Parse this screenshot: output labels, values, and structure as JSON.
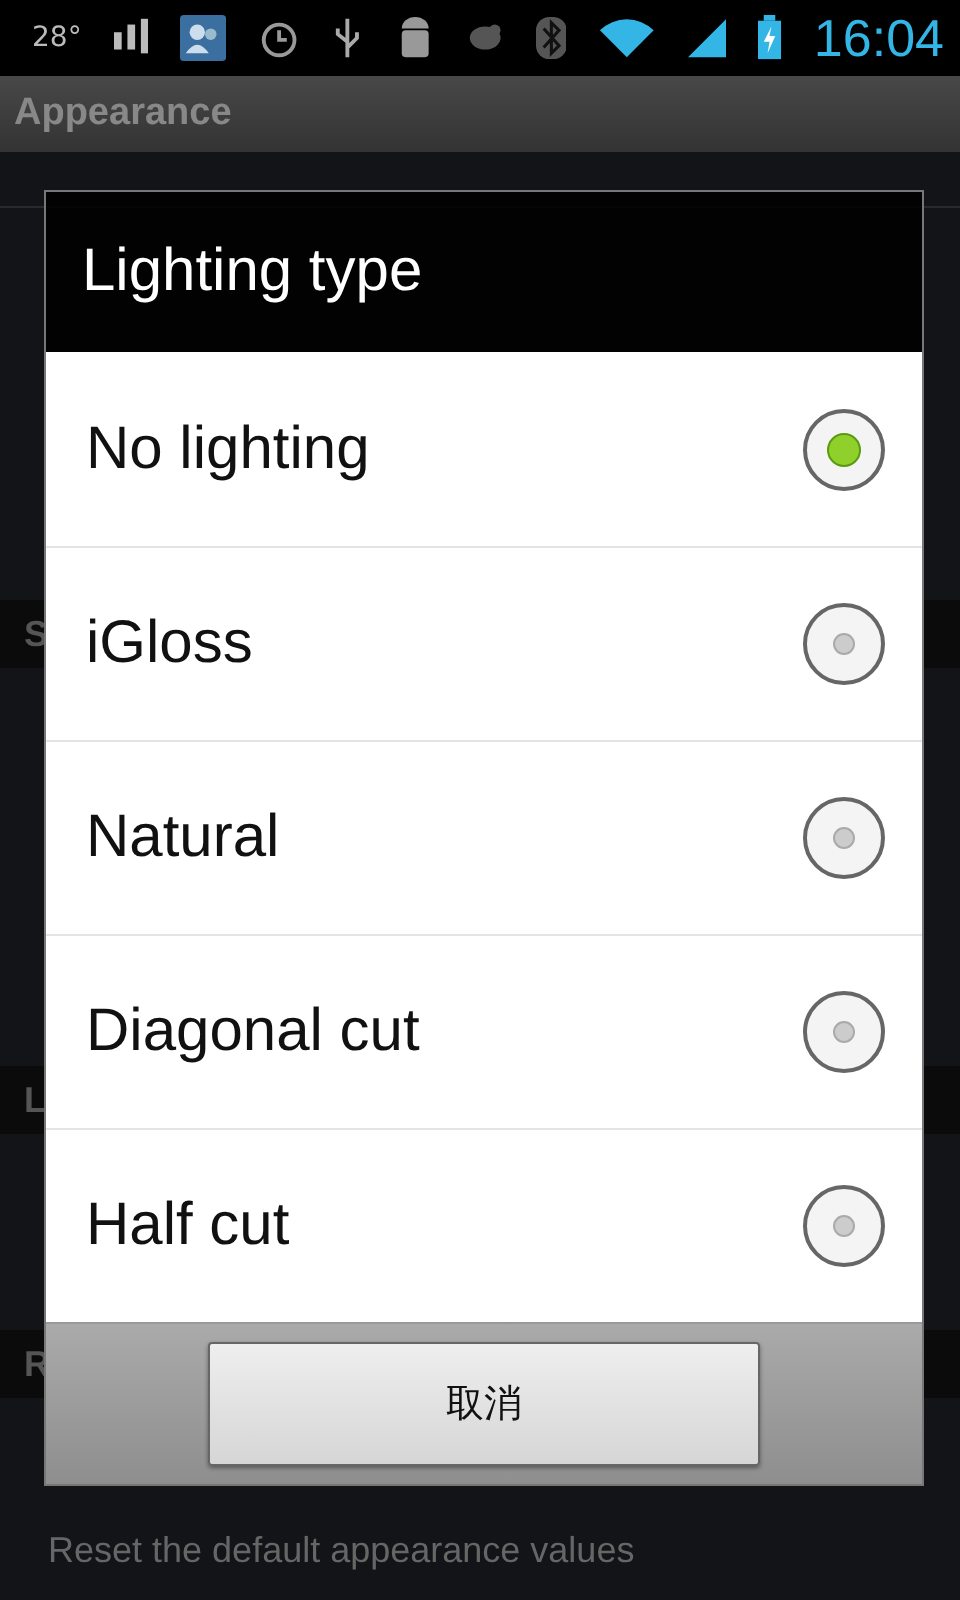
{
  "status_bar": {
    "temperature": "28°",
    "time": "16:04"
  },
  "action_bar": {
    "title": "Appearance"
  },
  "background": {
    "rows": [
      {
        "kind": "blank"
      },
      {
        "kind": "header",
        "title": "S"
      },
      {
        "kind": "blank"
      },
      {
        "kind": "header",
        "title": "L"
      },
      {
        "kind": "blank"
      },
      {
        "kind": "header",
        "title": "R"
      },
      {
        "kind": "row",
        "subtitle": "Reset the default appearance values"
      }
    ]
  },
  "dialog": {
    "title": "Lighting type",
    "options": [
      {
        "label": "No lighting",
        "selected": true
      },
      {
        "label": "iGloss",
        "selected": false
      },
      {
        "label": "Natural",
        "selected": false
      },
      {
        "label": "Diagonal cut",
        "selected": false
      },
      {
        "label": "Half cut",
        "selected": false
      }
    ],
    "cancel_button": "取消"
  }
}
